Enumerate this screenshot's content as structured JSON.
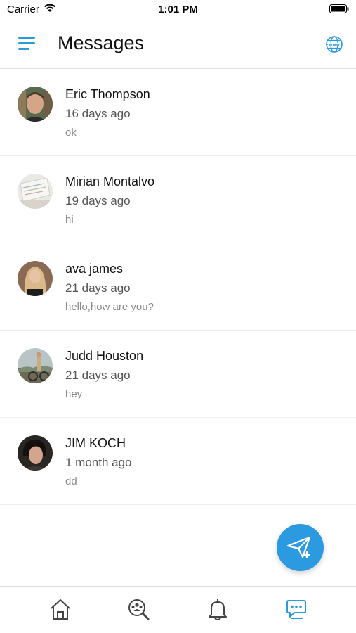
{
  "status_bar": {
    "carrier": "Carrier",
    "time": "1:01 PM"
  },
  "header": {
    "title": "Messages",
    "menu_icon": "hamburger-menu-icon",
    "globe_icon": "globe-icon"
  },
  "accent_color": "#2b9ae0",
  "messages": [
    {
      "name": "Eric Thompson",
      "time": "16 days ago",
      "preview": "ok"
    },
    {
      "name": "Mirian Montalvo",
      "time": "19 days ago",
      "preview": "hi"
    },
    {
      "name": "ava james",
      "time": "21 days ago",
      "preview": "hello,how are you?"
    },
    {
      "name": "Judd Houston",
      "time": "21 days ago",
      "preview": "hey"
    },
    {
      "name": "JIM KOCH",
      "time": "1 month ago",
      "preview": "dd"
    }
  ],
  "fab": {
    "icon": "send-plus-icon"
  },
  "tabs": [
    {
      "name": "home",
      "icon": "home-icon"
    },
    {
      "name": "search-people",
      "icon": "group-search-icon"
    },
    {
      "name": "notifications",
      "icon": "bell-icon"
    },
    {
      "name": "messages",
      "icon": "chat-icon",
      "active": true
    }
  ]
}
